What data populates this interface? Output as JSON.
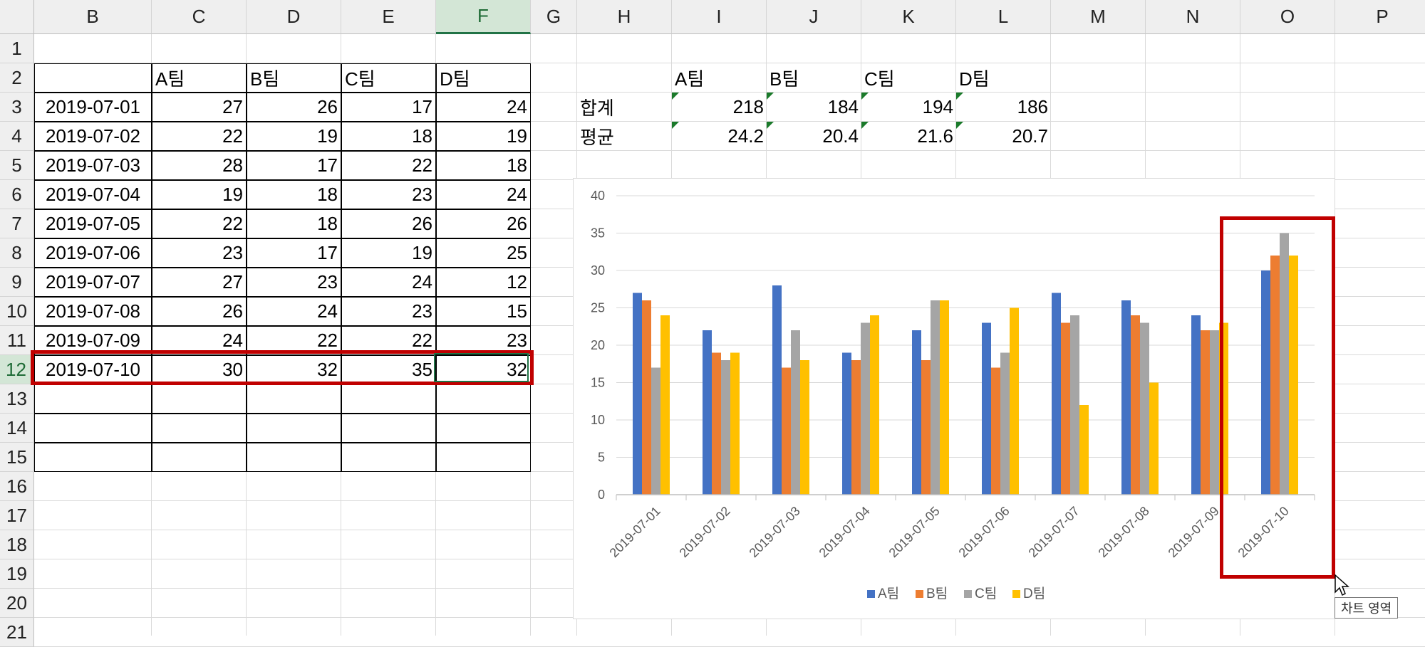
{
  "columns": [
    "B",
    "C",
    "D",
    "E",
    "F",
    "G",
    "H",
    "I",
    "J",
    "K",
    "L",
    "M",
    "N",
    "O",
    "P"
  ],
  "selected_column": "F",
  "rows": [
    "1",
    "2",
    "3",
    "4",
    "5",
    "6",
    "7",
    "8",
    "9",
    "10",
    "11",
    "12",
    "13",
    "14",
    "15",
    "16",
    "17",
    "18",
    "19",
    "20",
    "21"
  ],
  "selected_row": "12",
  "table": {
    "headers": [
      "A팀",
      "B팀",
      "C팀",
      "D팀"
    ],
    "rows": [
      [
        "2019-07-01",
        "27",
        "26",
        "17",
        "24"
      ],
      [
        "2019-07-02",
        "22",
        "19",
        "18",
        "19"
      ],
      [
        "2019-07-03",
        "28",
        "17",
        "22",
        "18"
      ],
      [
        "2019-07-04",
        "19",
        "18",
        "23",
        "24"
      ],
      [
        "2019-07-05",
        "22",
        "18",
        "26",
        "26"
      ],
      [
        "2019-07-06",
        "23",
        "17",
        "19",
        "25"
      ],
      [
        "2019-07-07",
        "27",
        "23",
        "24",
        "12"
      ],
      [
        "2019-07-08",
        "26",
        "24",
        "23",
        "15"
      ],
      [
        "2019-07-09",
        "24",
        "22",
        "22",
        "23"
      ],
      [
        "2019-07-10",
        "30",
        "32",
        "35",
        "32"
      ]
    ]
  },
  "summary": {
    "headers": [
      "A팀",
      "B팀",
      "C팀",
      "D팀"
    ],
    "rows": [
      {
        "label": "합계",
        "values": [
          "218",
          "184",
          "194",
          "186"
        ]
      },
      {
        "label": "평균",
        "values": [
          "24.2",
          "20.4",
          "21.6",
          "20.7"
        ]
      }
    ]
  },
  "chart_data": {
    "type": "bar",
    "categories": [
      "2019-07-01",
      "2019-07-02",
      "2019-07-03",
      "2019-07-04",
      "2019-07-05",
      "2019-07-06",
      "2019-07-07",
      "2019-07-08",
      "2019-07-09",
      "2019-07-10"
    ],
    "series": [
      {
        "name": "A팀",
        "values": [
          27,
          22,
          28,
          19,
          22,
          23,
          27,
          26,
          24,
          30
        ],
        "color": "#4472C4"
      },
      {
        "name": "B팀",
        "values": [
          26,
          19,
          17,
          18,
          18,
          17,
          23,
          24,
          22,
          32
        ],
        "color": "#ED7D31"
      },
      {
        "name": "C팀",
        "values": [
          17,
          18,
          22,
          23,
          26,
          19,
          24,
          23,
          22,
          35
        ],
        "color": "#A5A5A5"
      },
      {
        "name": "D팀",
        "values": [
          24,
          19,
          18,
          24,
          26,
          25,
          12,
          15,
          23,
          32
        ],
        "color": "#FFC000"
      }
    ],
    "yticks": [
      "0",
      "5",
      "10",
      "15",
      "20",
      "25",
      "30",
      "35",
      "40"
    ],
    "ylim": [
      0,
      40
    ],
    "grid": true,
    "legend": "bottom",
    "highlighted_category": "2019-07-10"
  },
  "tooltip": "차트 영역",
  "colors": {
    "highlight": "#c00000",
    "selection": "#217346"
  }
}
